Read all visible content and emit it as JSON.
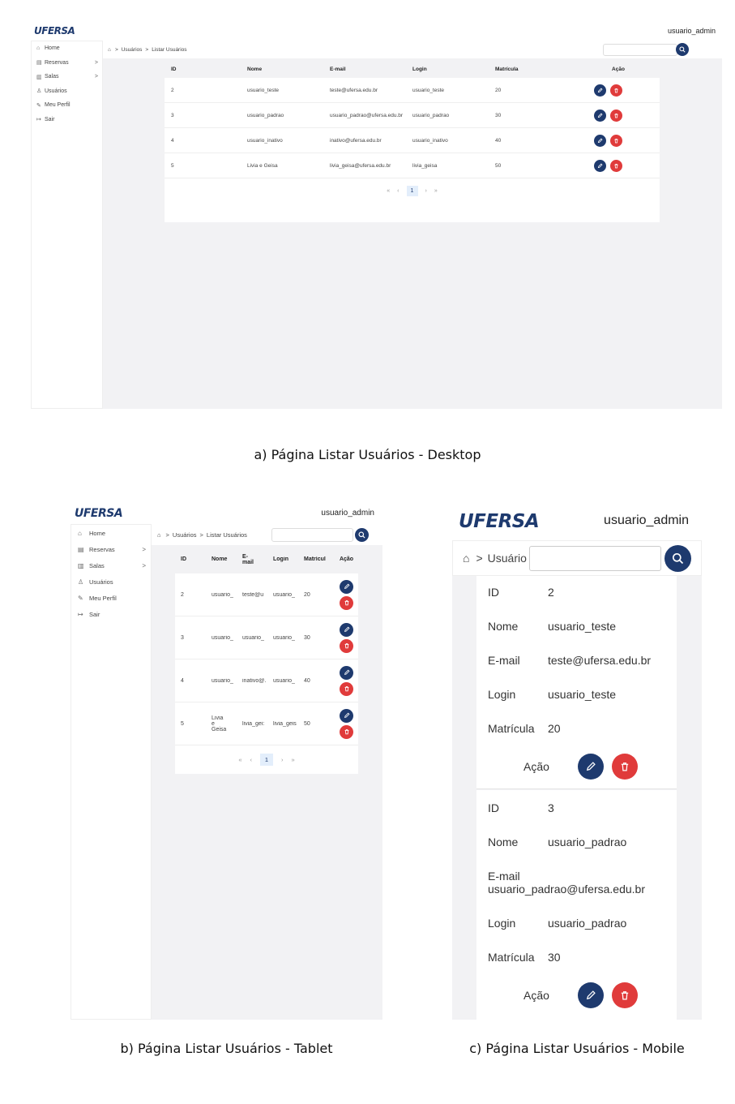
{
  "app": {
    "logo": "UFERSA",
    "user": "usuario_admin"
  },
  "sidebar": {
    "items": [
      {
        "label": "Home",
        "icon": "home-icon"
      },
      {
        "label": "Reservas",
        "icon": "calendar-icon"
      },
      {
        "label": "Salas",
        "icon": "map-icon"
      },
      {
        "label": "Usuários",
        "icon": "users-icon"
      },
      {
        "label": "Meu Perfil",
        "icon": "pencil-icon"
      },
      {
        "label": "Sair",
        "icon": "logout-icon"
      }
    ]
  },
  "breadcrumb": {
    "items": [
      "Usuários",
      "Listar Usuários"
    ],
    "mobile_truncated": "Usuário"
  },
  "table": {
    "headers": {
      "id": "ID",
      "nome": "Nome",
      "email": "E-mail",
      "login": "Login",
      "matricula": "Matrícula",
      "acao": "Ação"
    },
    "tablet_headers": {
      "email": "E-\nmail",
      "matricula": "Matrícul"
    },
    "rows": [
      {
        "id": "2",
        "nome": "usuario_teste",
        "email": "teste@ufersa.edu.br",
        "login": "usuario_teste",
        "matricula": "20"
      },
      {
        "id": "3",
        "nome": "usuario_padrao",
        "email": "usuario_padrao@ufersa.edu.br",
        "login": "usuario_padrao",
        "matricula": "30"
      },
      {
        "id": "4",
        "nome": "usuario_inativo",
        "email": "inativo@ufersa.edu.br",
        "login": "usuario_inativo",
        "matricula": "40"
      },
      {
        "id": "5",
        "nome": "Livia e Geisa",
        "email": "livia_geisa@ufersa.edu.br",
        "login": "livia_geisa",
        "matricula": "50"
      }
    ],
    "tablet_rows": [
      {
        "id": "2",
        "nome": "usuario_",
        "email": "teste@u",
        "login": "usuario_",
        "matricula": "20"
      },
      {
        "id": "3",
        "nome": "usuario_",
        "email": "usuario_",
        "login": "usuario_",
        "matricula": "30"
      },
      {
        "id": "4",
        "nome": "usuario_",
        "email": "inativo@.",
        "login": "usuario_",
        "matricula": "40"
      },
      {
        "id": "5",
        "nome": "Livia\ne\nGeisa",
        "email": "livia_gei:",
        "login": "livia_geis",
        "matricula": "50"
      }
    ]
  },
  "pagination": {
    "first": "«",
    "prev": "‹",
    "current": "1",
    "next": "›",
    "last": "»"
  },
  "captions": {
    "desktop": "a) Página Listar Usuários - Desktop",
    "tablet": "b) Página Listar Usuários - Tablet",
    "mobile": "c) Página Listar Usuários - Mobile"
  },
  "colors": {
    "brand": "#1e3a6e",
    "danger": "#e03b3b",
    "background": "#f2f2f4"
  }
}
